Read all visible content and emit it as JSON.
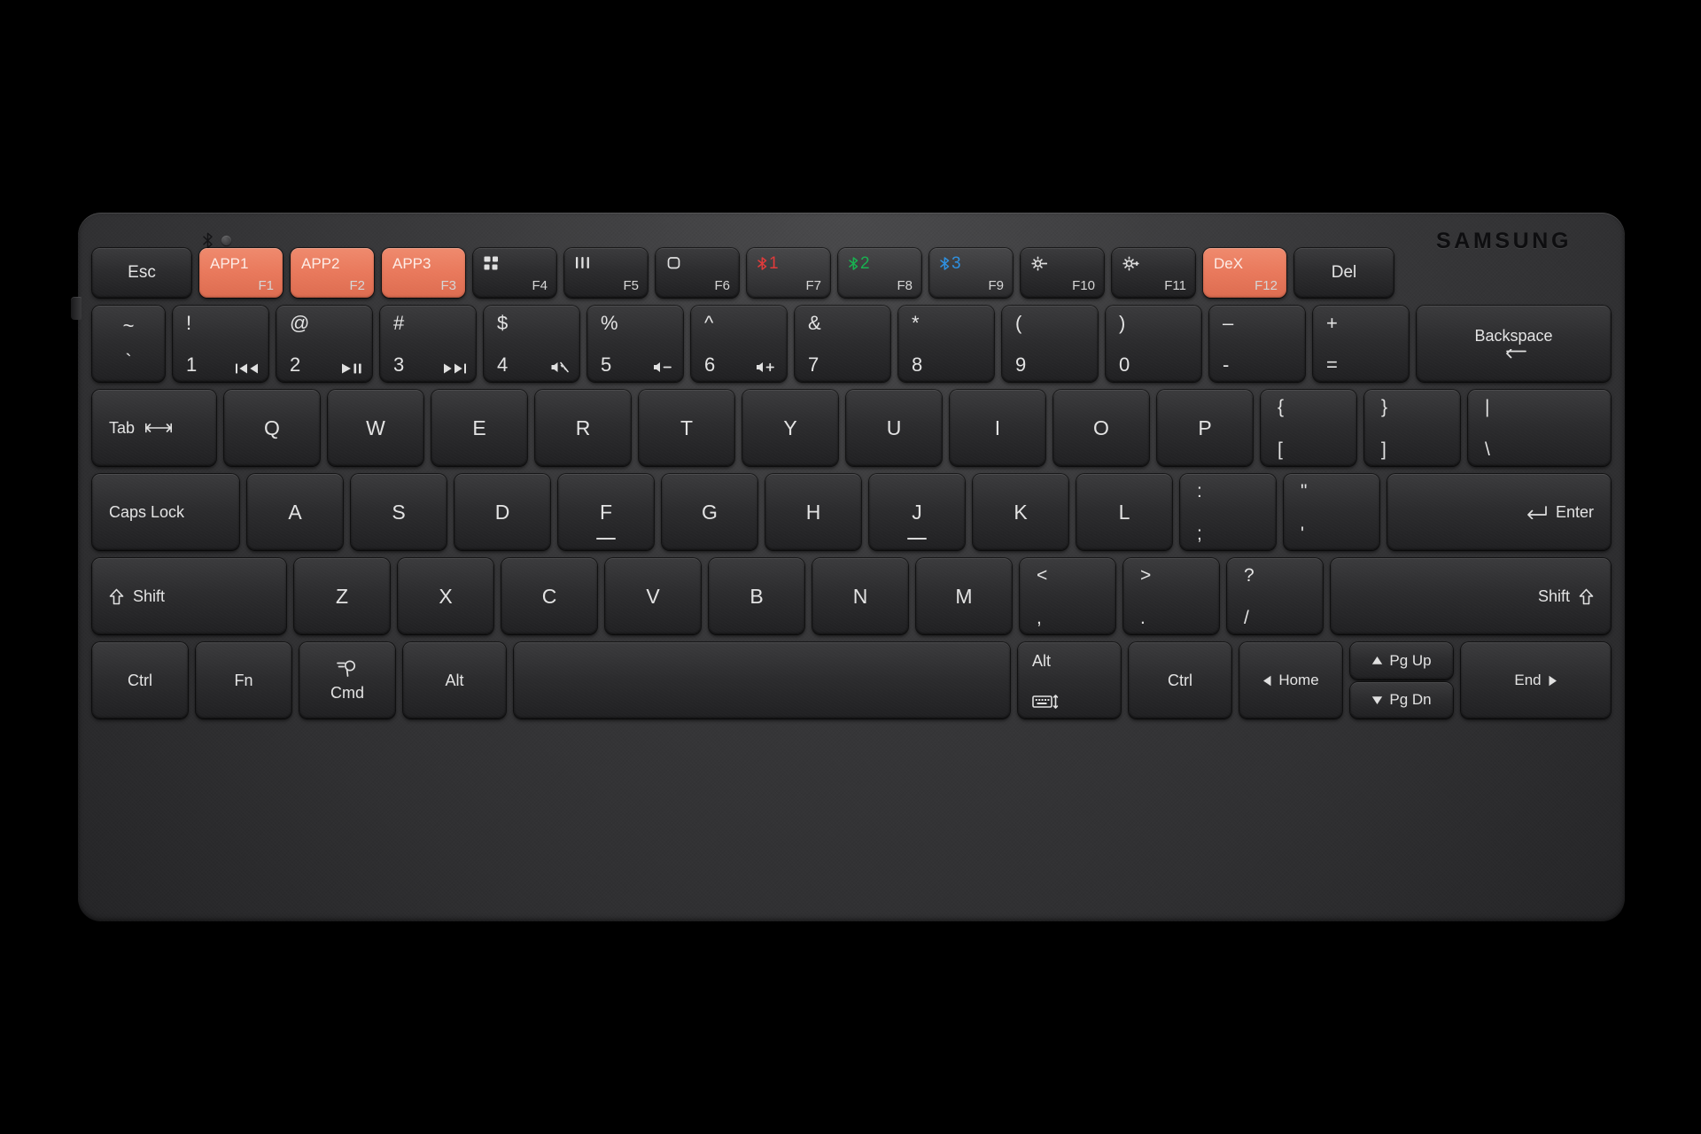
{
  "device": {
    "brand": "SAMSUNG",
    "bluetooth_icon": "bluetooth-icon",
    "led_indicator": "status-led"
  },
  "colors": {
    "accent_orange": "#E9795C",
    "body_dark": "#303032",
    "key_dark": "#2C2C2E",
    "key_text": "#E3E3E3",
    "bt1_red": "#E03A3A",
    "bt2_green": "#18B050",
    "bt3_blue": "#2E90E0"
  },
  "rows": {
    "function_row": [
      {
        "name": "esc",
        "label": "Esc",
        "fn": "",
        "accent": false,
        "lighter": false
      },
      {
        "name": "f1",
        "label": "APP1",
        "fn": "F1",
        "accent": true,
        "lighter": false
      },
      {
        "name": "f2",
        "label": "APP2",
        "fn": "F2",
        "accent": true,
        "lighter": false
      },
      {
        "name": "f3",
        "label": "APP3",
        "fn": "F3",
        "accent": true,
        "lighter": false
      },
      {
        "name": "f4",
        "label": "",
        "fn": "F4",
        "icon": "apps-grid-icon",
        "accent": false,
        "lighter": false
      },
      {
        "name": "f5",
        "label": "",
        "fn": "F5",
        "icon": "recents-icon",
        "accent": false,
        "lighter": false
      },
      {
        "name": "f6",
        "label": "",
        "fn": "F6",
        "icon": "home-square-icon",
        "accent": false,
        "lighter": false
      },
      {
        "name": "f7",
        "label": "1",
        "fn": "F7",
        "icon": "bluetooth-1-icon",
        "accent": false,
        "lighter": true
      },
      {
        "name": "f8",
        "label": "2",
        "fn": "F8",
        "icon": "bluetooth-2-icon",
        "accent": false,
        "lighter": true
      },
      {
        "name": "f9",
        "label": "3",
        "fn": "F9",
        "icon": "bluetooth-3-icon",
        "accent": false,
        "lighter": true
      },
      {
        "name": "f10",
        "label": "",
        "fn": "F10",
        "icon": "brightness-down-icon",
        "accent": false,
        "lighter": false
      },
      {
        "name": "f11",
        "label": "",
        "fn": "F11",
        "icon": "brightness-up-icon",
        "accent": false,
        "lighter": false
      },
      {
        "name": "f12",
        "label": "DeX",
        "fn": "F12",
        "accent": true,
        "lighter": false
      },
      {
        "name": "del",
        "label": "Del",
        "fn": "",
        "accent": false,
        "lighter": false
      }
    ],
    "number_row": [
      {
        "name": "backtick",
        "top": "~",
        "base": "`",
        "media": ""
      },
      {
        "name": "one",
        "top": "!",
        "base": "1",
        "media": "prev-track-icon"
      },
      {
        "name": "two",
        "top": "@",
        "base": "2",
        "media": "play-pause-icon"
      },
      {
        "name": "three",
        "top": "#",
        "base": "3",
        "media": "next-track-icon"
      },
      {
        "name": "four",
        "top": "$",
        "base": "4",
        "media": "mute-icon"
      },
      {
        "name": "five",
        "top": "%",
        "base": "5",
        "media": "volume-down-icon"
      },
      {
        "name": "six",
        "top": "^",
        "base": "6",
        "media": "volume-up-icon"
      },
      {
        "name": "seven",
        "top": "&",
        "base": "7",
        "media": ""
      },
      {
        "name": "eight",
        "top": "*",
        "base": "8",
        "media": ""
      },
      {
        "name": "nine",
        "top": "(",
        "base": "9",
        "media": ""
      },
      {
        "name": "zero",
        "top": ")",
        "base": "0",
        "media": ""
      },
      {
        "name": "minus",
        "top": "–",
        "base": "-",
        "media": ""
      },
      {
        "name": "equals",
        "top": "+",
        "base": "=",
        "media": ""
      }
    ],
    "backspace": {
      "label": "Backspace",
      "icon": "backspace-arrow-icon"
    },
    "tab": {
      "label": "Tab",
      "icon": "tab-arrows-icon"
    },
    "qwerty_row": [
      "Q",
      "W",
      "E",
      "R",
      "T",
      "Y",
      "U",
      "I",
      "O",
      "P"
    ],
    "qwerty_extra": [
      {
        "name": "left-bracket",
        "top": "{",
        "bot": "["
      },
      {
        "name": "right-bracket",
        "top": "}",
        "bot": "]"
      },
      {
        "name": "backslash",
        "top": "|",
        "bot": "\\"
      }
    ],
    "caps_lock": "Caps Lock",
    "asdf_row": [
      "A",
      "S",
      "D",
      "F",
      "G",
      "H",
      "J",
      "K",
      "L"
    ],
    "asdf_extra": [
      {
        "name": "semicolon",
        "top": ":",
        "bot": ";"
      },
      {
        "name": "quote",
        "top": "\"",
        "bot": "'"
      }
    ],
    "enter": {
      "label": "Enter",
      "icon": "enter-arrow-icon"
    },
    "shift_left": {
      "label": "Shift",
      "icon": "shift-up-arrow-icon"
    },
    "zxcv_row": [
      "Z",
      "X",
      "C",
      "V",
      "B",
      "N",
      "M"
    ],
    "zxcv_extra": [
      {
        "name": "comma",
        "top": "<",
        "bot": ","
      },
      {
        "name": "period",
        "top": ">",
        "bot": "."
      },
      {
        "name": "slash",
        "top": "?",
        "bot": "/"
      }
    ],
    "shift_right": {
      "label": "Shift",
      "icon": "shift-up-arrow-icon"
    },
    "bottom_row": {
      "ctrl_left": "Ctrl",
      "fn": "Fn",
      "cmd": {
        "label": "Cmd",
        "icon": "search-icon"
      },
      "alt_left": "Alt",
      "space": "",
      "alt_right": {
        "label": "Alt",
        "icon": "keyboard-toggle-icon"
      },
      "ctrl_right": "Ctrl",
      "home": {
        "label": "Home",
        "icon": "arrow-left-icon"
      },
      "pg_up": {
        "label": "Pg Up",
        "icon": "arrow-up-icon"
      },
      "pg_dn": {
        "label": "Pg Dn",
        "icon": "arrow-down-icon"
      },
      "end": {
        "label": "End",
        "icon": "arrow-right-icon"
      }
    }
  }
}
